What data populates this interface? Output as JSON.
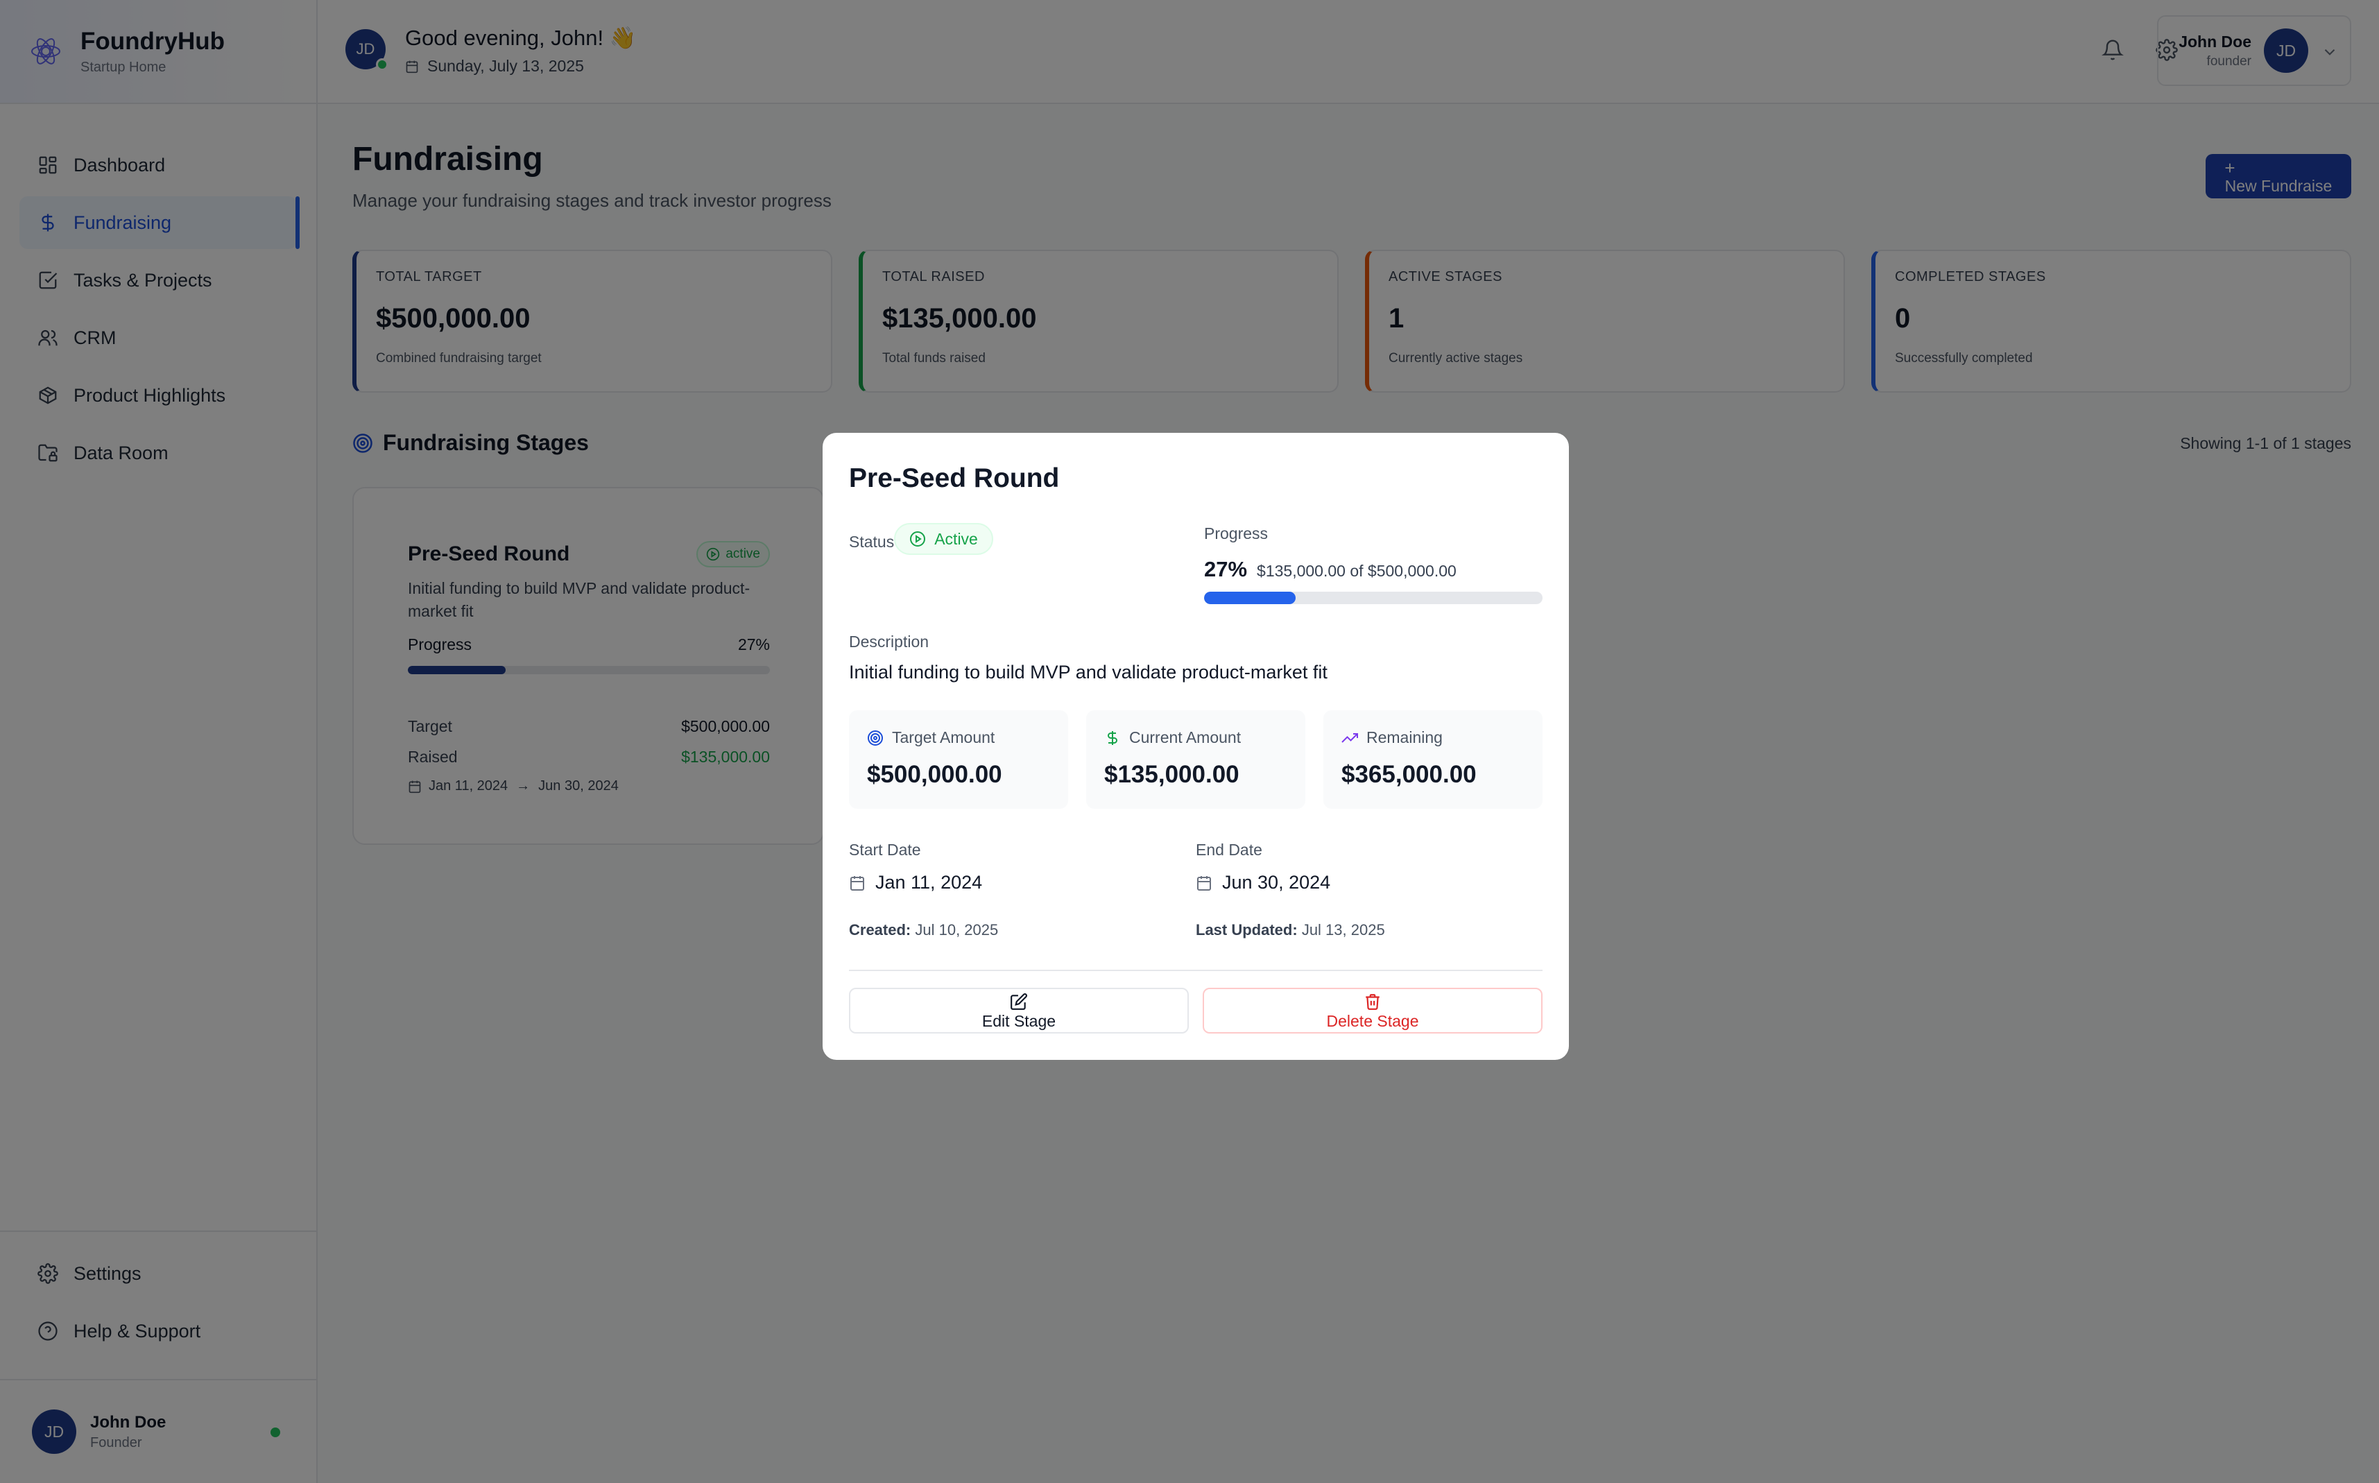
{
  "brand": {
    "name": "FoundryHub",
    "subtitle": "Startup Home"
  },
  "sidebar": {
    "items": [
      {
        "label": "Dashboard",
        "icon": "dashboard-icon",
        "active": false
      },
      {
        "label": "Fundraising",
        "icon": "dollar-icon",
        "active": true
      },
      {
        "label": "Tasks & Projects",
        "icon": "check-square-icon",
        "active": false
      },
      {
        "label": "CRM",
        "icon": "users-icon",
        "active": false
      },
      {
        "label": "Product Highlights",
        "icon": "box-icon",
        "active": false
      },
      {
        "label": "Data Room",
        "icon": "folder-icon",
        "active": false
      }
    ],
    "bottom": [
      {
        "label": "Settings",
        "icon": "gear-icon"
      },
      {
        "label": "Help & Support",
        "icon": "help-icon"
      }
    ],
    "user": {
      "initials": "JD",
      "name": "John Doe",
      "role": "Founder"
    }
  },
  "topbar": {
    "initials": "JD",
    "greeting": "Good evening, John! 👋",
    "date": "Sunday, July 13, 2025",
    "user": {
      "name": "John Doe",
      "role": "founder",
      "initials": "JD"
    }
  },
  "page": {
    "title": "Fundraising",
    "subtitle": "Manage your fundraising stages and track investor progress",
    "new_button": "New Fundraise"
  },
  "stats": [
    {
      "label": "TOTAL TARGET",
      "value": "$500,000.00",
      "sub": "Combined fundraising target",
      "color": "#1e3a8a"
    },
    {
      "label": "TOTAL RAISED",
      "value": "$135,000.00",
      "sub": "Total funds raised",
      "color": "#16a34a"
    },
    {
      "label": "ACTIVE STAGES",
      "value": "1",
      "sub": "Currently active stages",
      "color": "#ea580c"
    },
    {
      "label": "COMPLETED STAGES",
      "value": "0",
      "sub": "Successfully completed",
      "color": "#2563eb"
    }
  ],
  "stages": {
    "heading": "Fundraising Stages",
    "count": "Showing 1-1 of 1 stages",
    "card": {
      "title": "Pre-Seed Round",
      "status": "active",
      "description": "Initial funding to build MVP and validate product-market fit",
      "progress_label": "Progress",
      "progress_pct": "27%",
      "progress": 0.27,
      "target_label": "Target",
      "target": "$500,000.00",
      "raised_label": "Raised",
      "raised": "$135,000.00",
      "start": "Jan 11, 2024",
      "arrow": "→",
      "end": "Jun 30, 2024"
    }
  },
  "modal": {
    "title": "Pre-Seed Round",
    "status_label": "Status",
    "status": "Active",
    "progress_label": "Progress",
    "progress_pct": "27%",
    "progress_of": "$135,000.00 of $500,000.00",
    "progress": 0.27,
    "description_label": "Description",
    "description": "Initial funding to build MVP and validate product-market fit",
    "cards": [
      {
        "label": "Target Amount",
        "value": "$500,000.00",
        "icon": "target-icon"
      },
      {
        "label": "Current Amount",
        "value": "$135,000.00",
        "icon": "dollar-icon"
      },
      {
        "label": "Remaining",
        "value": "$365,000.00",
        "icon": "trending-up-icon"
      }
    ],
    "start_label": "Start Date",
    "start": "Jan 11, 2024",
    "end_label": "End Date",
    "end": "Jun 30, 2024",
    "created_label": "Created:",
    "created": "Jul 10, 2025",
    "updated_label": "Last Updated:",
    "updated": "Jul 13, 2025",
    "edit_button": "Edit Stage",
    "delete_button": "Delete Stage"
  }
}
